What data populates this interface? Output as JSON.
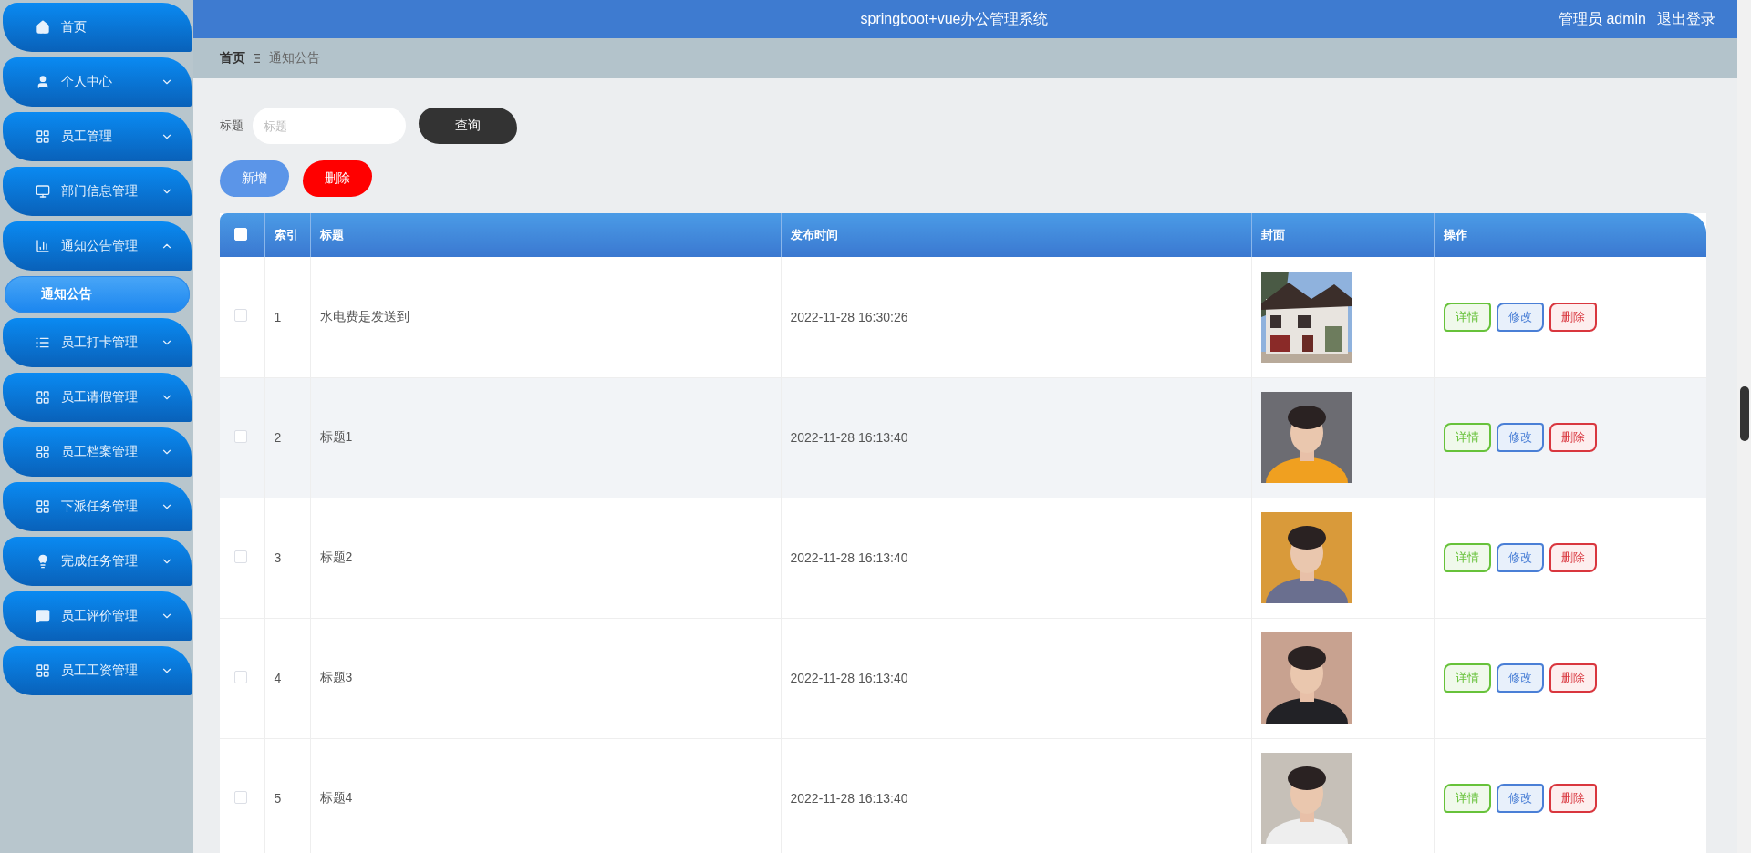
{
  "sidebar": {
    "items": [
      {
        "kind": "link",
        "label": "首页"
      },
      {
        "kind": "menu",
        "label": "个人中心",
        "expanded": false
      },
      {
        "kind": "menu",
        "label": "员工管理",
        "expanded": false
      },
      {
        "kind": "menu",
        "label": "部门信息管理",
        "expanded": false
      },
      {
        "kind": "menu",
        "label": "通知公告管理",
        "expanded": true,
        "children": [
          {
            "label": "通知公告",
            "selected": true
          }
        ]
      },
      {
        "kind": "menu",
        "label": "员工打卡管理",
        "expanded": false
      },
      {
        "kind": "menu",
        "label": "员工请假管理",
        "expanded": false
      },
      {
        "kind": "menu",
        "label": "员工档案管理",
        "expanded": false
      },
      {
        "kind": "menu",
        "label": "下派任务管理",
        "expanded": false
      },
      {
        "kind": "menu",
        "label": "完成任务管理",
        "expanded": false
      },
      {
        "kind": "menu",
        "label": "员工评价管理",
        "expanded": false
      },
      {
        "kind": "menu",
        "label": "员工工资管理",
        "expanded": false
      }
    ]
  },
  "header": {
    "title": "springboot+vue办公管理系统",
    "user": "管理员 admin",
    "logout": "退出登录"
  },
  "breadcrumb": [
    "首页",
    "通知公告"
  ],
  "search": {
    "label": "标题",
    "placeholder": "标题",
    "button": "查询"
  },
  "actions": [
    "新增",
    "删除"
  ],
  "table": {
    "select_all_checked": false,
    "columns": [
      "索引",
      "标题",
      "发布时间",
      "封面",
      "操作"
    ],
    "rows": [
      {
        "checked": false,
        "highlighted": false,
        "index": "1",
        "title": "水电费是发送到",
        "time": "2022-11-28 16:30:26",
        "buttons": [
          "详情",
          "修改",
          "删除"
        ]
      },
      {
        "checked": false,
        "highlighted": true,
        "index": "2",
        "title": "标题1",
        "time": "2022-11-28 16:13:40",
        "buttons": [
          "详情",
          "修改",
          "删除"
        ]
      },
      {
        "checked": false,
        "highlighted": false,
        "index": "3",
        "title": "标题2",
        "time": "2022-11-28 16:13:40",
        "buttons": [
          "详情",
          "修改",
          "删除"
        ]
      },
      {
        "checked": false,
        "highlighted": false,
        "index": "4",
        "title": "标题3",
        "time": "2022-11-28 16:13:40",
        "buttons": [
          "详情",
          "修改",
          "删除"
        ]
      },
      {
        "checked": false,
        "highlighted": false,
        "index": "5",
        "title": "标题4",
        "time": "2022-11-28 16:13:40",
        "buttons": [
          "详情",
          "修改",
          "删除"
        ]
      }
    ]
  }
}
